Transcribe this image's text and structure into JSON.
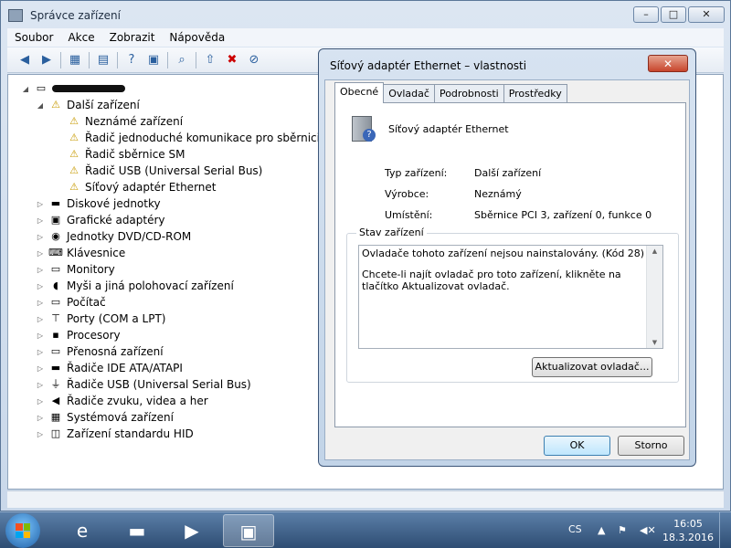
{
  "window": {
    "title": "Správce zařízení",
    "controls": {
      "minimize": "–",
      "maximize": "□",
      "close": "✕"
    }
  },
  "menu": [
    "Soubor",
    "Akce",
    "Zobrazit",
    "Nápověda"
  ],
  "toolbar_icons": [
    "back-arrow-icon",
    "forward-arrow-icon",
    "show-hide-tree-icon",
    "properties-icon",
    "help-icon",
    "action-pane-icon",
    "scan-hardware-icon",
    "update-driver-icon",
    "disable-device-icon",
    "uninstall-device-icon"
  ],
  "tree": {
    "dalsi": {
      "label": "Další zařízení",
      "children": [
        "Neznámé zařízení",
        "Řadič jednoduché komunikace pro sběrnici PCI",
        "Řadič sběrnice SM",
        "Řadič USB (Universal Serial Bus)",
        "Síťový adaptér Ethernet"
      ]
    },
    "categories": [
      "Diskové jednotky",
      "Grafické adaptéry",
      "Jednotky DVD/CD-ROM",
      "Klávesnice",
      "Monitory",
      "Myši a jiná polohovací zařízení",
      "Počítač",
      "Porty (COM a LPT)",
      "Procesory",
      "Přenosná zařízení",
      "Řadiče IDE ATA/ATAPI",
      "Řadiče USB (Universal Serial Bus)",
      "Řadiče zvuku, videa a her",
      "Systémová zařízení",
      "Zařízení standardu HID"
    ]
  },
  "dialog": {
    "title": "Síťový adaptér Ethernet – vlastnosti",
    "close": "✕",
    "tabs": [
      "Obecné",
      "Ovladač",
      "Podrobnosti",
      "Prostředky"
    ],
    "device_name": "Síťový adaptér Ethernet",
    "props": {
      "type_label": "Typ zařízení:",
      "type_value": "Další zařízení",
      "maker_label": "Výrobce:",
      "maker_value": "Neznámý",
      "location_label": "Umístění:",
      "location_value": "Sběrnice PCI 3, zařízení 0, funkce 0"
    },
    "status_label": "Stav zařízení",
    "status_line1": "Ovladače tohoto zařízení nejsou nainstalovány. (Kód 28)",
    "status_line2": "Chcete-li najít ovladač pro toto zařízení, klikněte na tlačítko Aktualizovat ovladač.",
    "update_button": "Aktualizovat ovladač...",
    "ok": "OK",
    "cancel": "Storno"
  },
  "taskbar": {
    "lang": "CS",
    "time": "16:05",
    "date": "18.3.2016"
  }
}
